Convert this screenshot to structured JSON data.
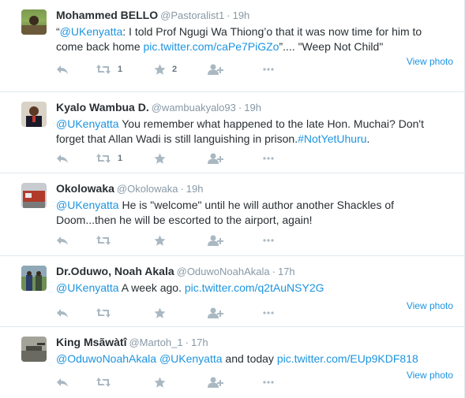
{
  "tweets": [
    {
      "name": "Mohammed BELLO",
      "handle": "@Pastoralist1",
      "time": "19h",
      "parts": [
        {
          "t": "“",
          "link": false
        },
        {
          "t": "@UKenyatta",
          "link": true
        },
        {
          "t": ": I told Prof Ngugi Wa Thiong’o that it was now time for him to come back home ",
          "link": false
        },
        {
          "t": "pic.twitter.com/caPe7PiGZo",
          "link": true
        },
        {
          "t": "”.... \"Weep Not Child\"",
          "link": false
        }
      ],
      "view_photo": "View photo",
      "retweets": "1",
      "favorites": "2"
    },
    {
      "name": "Kyalo Wambua D.",
      "handle": "@wambuakyalo93",
      "time": "19h",
      "parts": [
        {
          "t": "@UKenyatta",
          "link": true
        },
        {
          "t": " You remember what happened to the late Hon. Muchai? Don't forget that Allan Wadi is still languishing in prison.",
          "link": false
        },
        {
          "t": "#NotYetUhuru",
          "link": true
        },
        {
          "t": ".",
          "link": false
        }
      ],
      "view_photo": "",
      "retweets": "1",
      "favorites": ""
    },
    {
      "name": "Okolowaka",
      "handle": "@Okolowaka",
      "time": "19h",
      "parts": [
        {
          "t": "@UKenyatta",
          "link": true
        },
        {
          "t": " He is \"welcome\" until he will author another Shackles of Doom...then he will be escorted to the airport, again!",
          "link": false
        }
      ],
      "view_photo": "",
      "retweets": "",
      "favorites": ""
    },
    {
      "name": "Dr.Oduwo, Noah Akala",
      "handle": "@OduwoNoahAkala",
      "time": "17h",
      "parts": [
        {
          "t": "@UKenyatta",
          "link": true
        },
        {
          "t": " A week ago. ",
          "link": false
        },
        {
          "t": "pic.twitter.com/q2tAuNSY2G",
          "link": true
        }
      ],
      "view_photo": "View photo",
      "retweets": "",
      "favorites": ""
    },
    {
      "name": "King Msãwàtî",
      "handle": "@Martoh_1",
      "time": "17h",
      "parts": [
        {
          "t": "@OduwoNoahAkala",
          "link": true
        },
        {
          "t": " ",
          "link": false
        },
        {
          "t": "@UKenyatta",
          "link": true
        },
        {
          "t": " and today ",
          "link": false
        },
        {
          "t": "pic.twitter.com/EUp9KDF818",
          "link": true
        }
      ],
      "view_photo": "View photo",
      "retweets": "",
      "favorites": ""
    }
  ],
  "colors": {
    "link": "#1c94e0",
    "name": "#292f33",
    "meta": "#8899a6",
    "icon": "#aab8c2"
  }
}
